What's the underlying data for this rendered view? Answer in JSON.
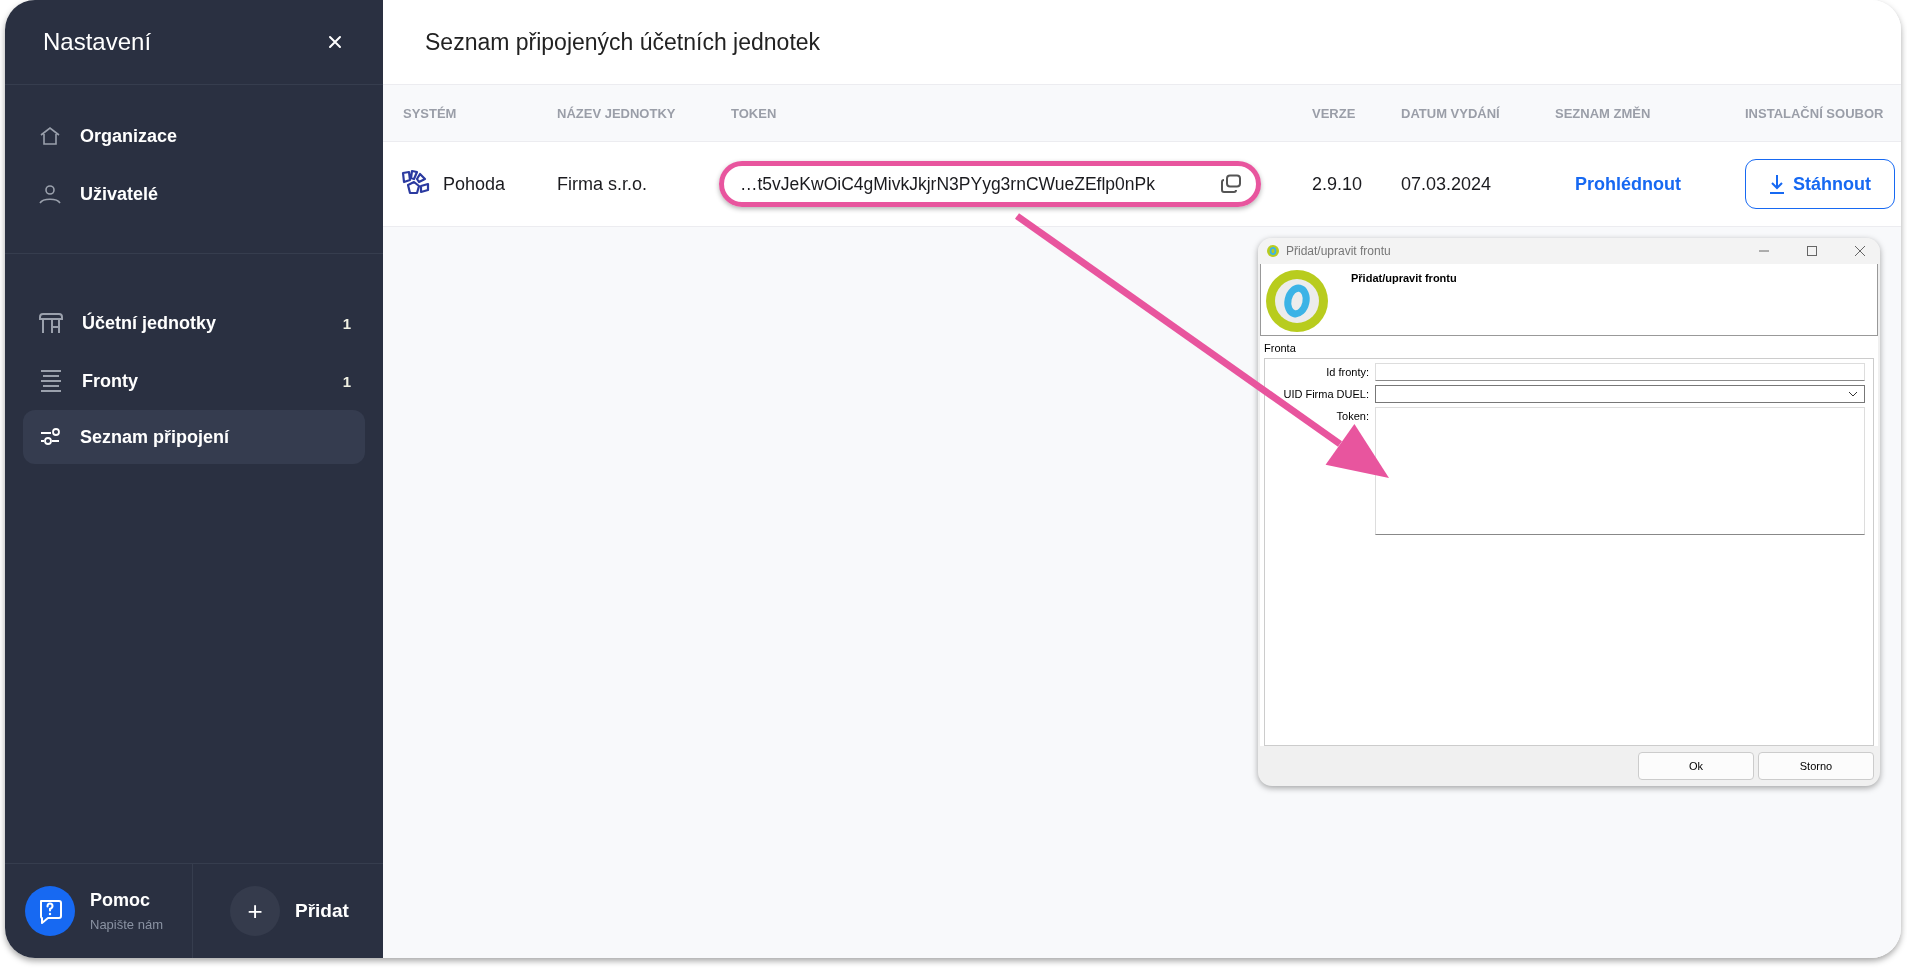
{
  "sidebar": {
    "title": "Nastavení",
    "groups": [
      [
        {
          "label": "Organizace",
          "kind": "home",
          "selected": false
        },
        {
          "label": "Uživatelé",
          "kind": "user",
          "selected": false
        }
      ],
      [
        {
          "label": "Účetní jednotky",
          "kind": "table",
          "count": "1",
          "selected": false
        },
        {
          "label": "Fronty",
          "kind": "queue",
          "count": "1",
          "selected": false
        },
        {
          "label": "Seznam připojení",
          "kind": "sliders",
          "selected": true
        }
      ]
    ],
    "help": {
      "title": "Pomoc",
      "subtitle": "Napište nám"
    },
    "add": {
      "label": "Přidat",
      "icon": "+"
    }
  },
  "page": {
    "title": "Seznam připojených účetních jednotek"
  },
  "table": {
    "columns": [
      "SYSTÉM",
      "NÁZEV JEDNOTKY",
      "TOKEN",
      "VERZE",
      "DATUM VYDÁNÍ",
      "SEZNAM ZMĚN",
      "INSTALAČNÍ SOUBOR"
    ],
    "rows": [
      {
        "system": "Pohoda",
        "unit": "Firma s.r.o.",
        "token": "…t5vJeKwOiC4gMivkJkjrN3PYyg3rnCWueZEflp0nPk",
        "token_highlighted": true,
        "version": "2.9.10",
        "date": "07.03.2024",
        "changelog": "Prohlédnout",
        "download": "Stáhnout"
      }
    ]
  },
  "dialog": {
    "window_title": "Přidat/upravit frontu",
    "heading": "Přidat/upravit frontu",
    "group": "Fronta",
    "fields": [
      {
        "label": "Id fronty:",
        "kind": "text"
      },
      {
        "label": "UID Firma DUEL:",
        "kind": "select"
      },
      {
        "label": "Token:",
        "kind": "textarea"
      }
    ],
    "buttons": [
      "Ok",
      "Storno"
    ]
  }
}
